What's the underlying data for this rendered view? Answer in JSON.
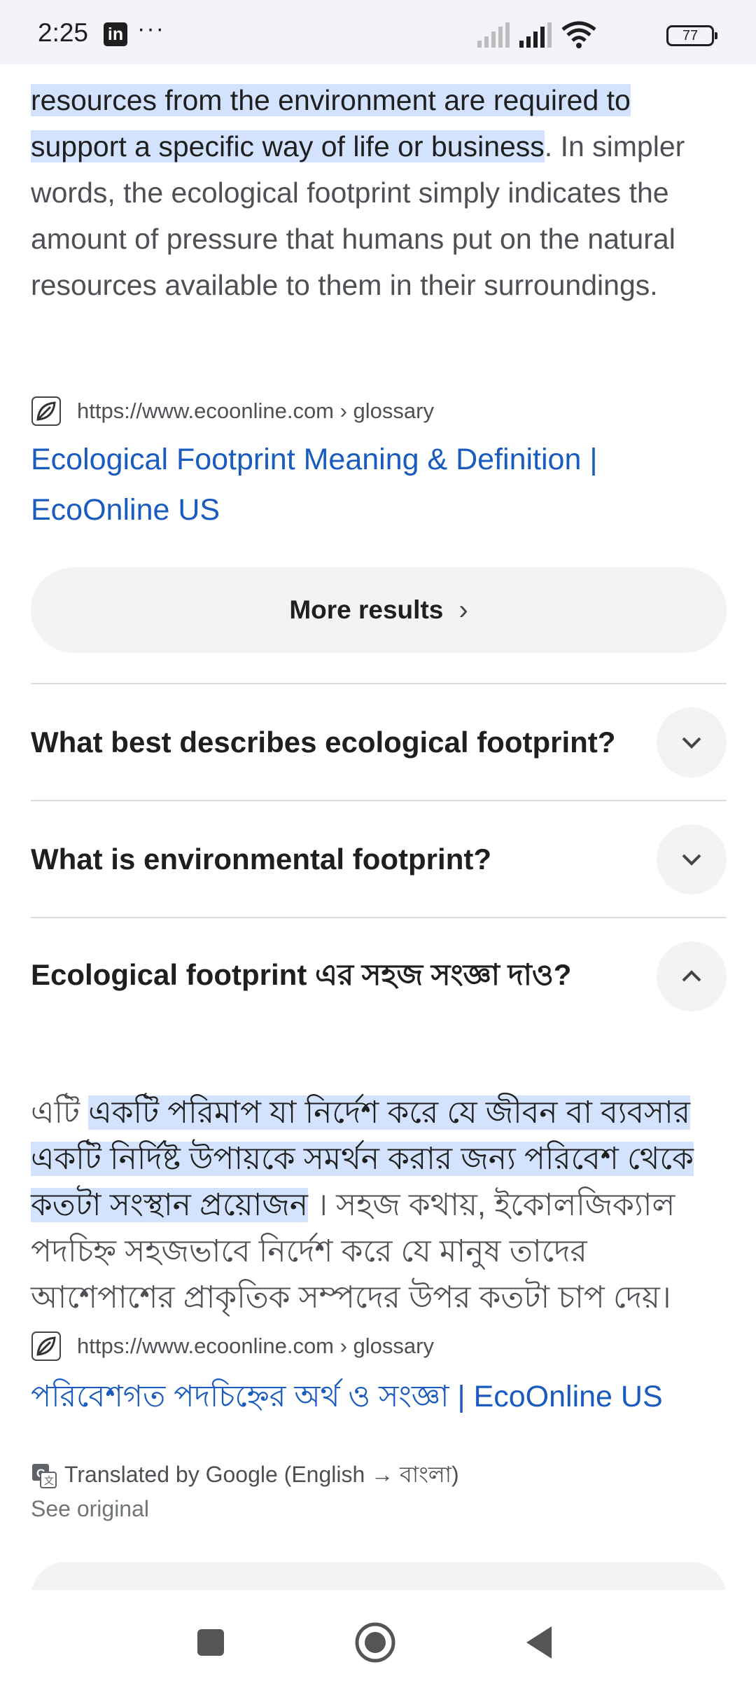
{
  "status": {
    "time": "2:25",
    "app_badge": "in",
    "more": "···",
    "battery": "77"
  },
  "result1": {
    "snippet_highlight": "resources from the environment are required to support a specific way of life or business",
    "snippet_rest": ". In simpler words, the ecological footprint simply indicates the amount of pressure that humans put on the natural resources available to them in their surroundings.",
    "source_url": "https://www.ecoonline.com › glossary",
    "title": "Ecological Footprint Meaning & Definition | EcoOnline US"
  },
  "more_results": {
    "label": "More results",
    "chevron": "›"
  },
  "questions": [
    {
      "text": "What best describes ecological footprint?",
      "expanded": false
    },
    {
      "text": "What is environmental footprint?",
      "expanded": false
    },
    {
      "text": "Ecological footprint এর সহজ সংজ্ঞা দাও?",
      "expanded": true
    }
  ],
  "answer": {
    "prefix": "এটি ",
    "highlight": "একটি পরিমাপ যা নির্দেশ করে যে জীবন বা ব্যবসার একটি নির্দিষ্ট উপায়কে সমর্থন করার জন্য পরিবেশ থেকে কতটা সংস্থান প্রয়োজন",
    "rest": " । সহজ কথায়, ইকোলজিক্যাল পদচিহ্ন সহজভাবে নির্দেশ করে যে মানুষ তাদের আশেপাশের প্রাকৃতিক সম্পদের উপর কতটা চাপ দেয়।",
    "source_url": "https://www.ecoonline.com › glossary",
    "title": "পরিবেশগত পদচিহ্নের অর্থ ও সংজ্ঞা | EcoOnline US",
    "translated_note": "Translated by Google (English → বাংলা)",
    "see_original": "See original"
  },
  "icons": {
    "source": "ecoonline-leaf-icon",
    "translate": "google-translate-icon",
    "chevron_down": "chevron-down-icon",
    "chevron_up": "chevron-up-icon",
    "nav_recents": "square-icon",
    "nav_home": "circle-icon",
    "nav_back": "triangle-icon"
  },
  "colors": {
    "highlight": "#d3e3fd",
    "link": "#1a5bbf",
    "status_bg": "#f3f4f9"
  }
}
